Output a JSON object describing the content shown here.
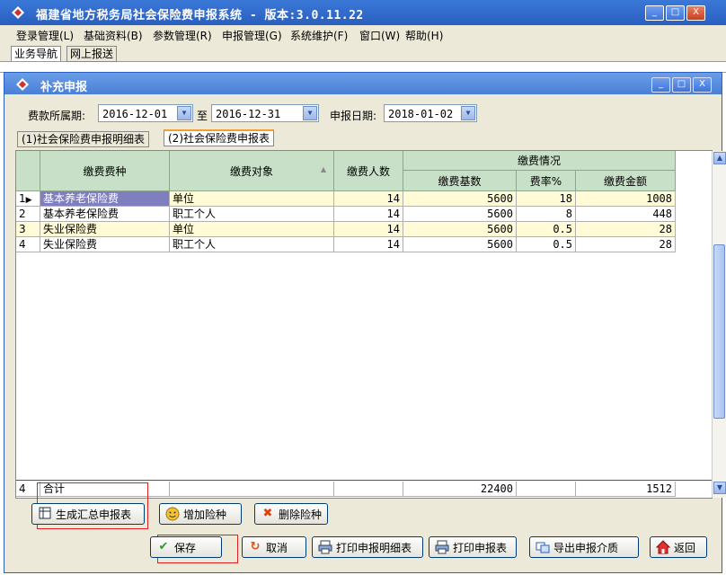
{
  "app": {
    "title": "福建省地方税务局社会保险费申报系统 - 版本:3.0.11.22"
  },
  "window_buttons": [
    "_",
    "□",
    "X"
  ],
  "menu": [
    {
      "label": "登录管理(L)"
    },
    {
      "label": "基础资料(B)"
    },
    {
      "label": "参数管理(R)"
    },
    {
      "label": "申报管理(G)"
    },
    {
      "label": "系统维护(F)"
    },
    {
      "label": "窗口(W)"
    },
    {
      "label": "帮助(H)"
    }
  ],
  "nav_tabs": [
    {
      "label": "业务导航"
    },
    {
      "label": "网上报送"
    }
  ],
  "dialog": {
    "title": "补充申报",
    "period_label": "费款所属期:",
    "period_from": "2016-12-01",
    "to_label": "至",
    "period_to": "2016-12-31",
    "date_label": "申报日期:",
    "declare_date": "2018-01-02",
    "tabs": [
      {
        "label": "(1)社会保险费申报明细表"
      },
      {
        "label": "(2)社会保险费申报表"
      }
    ]
  },
  "grid": {
    "headers": {
      "type": "缴费费种",
      "target": "缴费对象",
      "count": "缴费人数",
      "group": "缴费情况",
      "base": "缴费基数",
      "rate": "费率%",
      "amount": "缴费金额"
    },
    "rows": [
      {
        "idx": "1",
        "type": "基本养老保险费",
        "target": "单位",
        "count": "14",
        "base": "5600",
        "rate": "18",
        "amount": "1008"
      },
      {
        "idx": "2",
        "type": "基本养老保险费",
        "target": "职工个人",
        "count": "14",
        "base": "5600",
        "rate": "8",
        "amount": "448"
      },
      {
        "idx": "3",
        "type": "失业保险费",
        "target": "单位",
        "count": "14",
        "base": "5600",
        "rate": "0.5",
        "amount": "28"
      },
      {
        "idx": "4",
        "type": "失业保险费",
        "target": "职工个人",
        "count": "14",
        "base": "5600",
        "rate": "0.5",
        "amount": "28"
      }
    ],
    "footer": {
      "idx": "4",
      "label": "合计",
      "base": "22400",
      "amount": "1512"
    }
  },
  "buttons": {
    "generate": "生成汇总申报表",
    "add": "增加险种",
    "delete": "删除险种",
    "save": "保存",
    "cancel": "取消",
    "print_detail": "打印申报明细表",
    "print": "打印申报表",
    "export": "导出申报介质",
    "back": "返回"
  },
  "colors": {
    "title_bar": "#2a5fbf",
    "header_green": "#c8e0c8",
    "selected_row": "#fffbd6",
    "highlight_box": "#e02020"
  }
}
